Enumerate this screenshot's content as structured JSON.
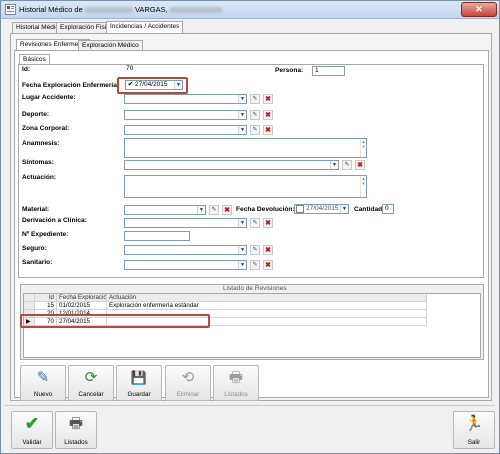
{
  "window": {
    "title": "Historial Médico de",
    "title_suffix": "VARGAS,",
    "close_glyph": "✕"
  },
  "top_tabs": [
    "Historial Médico",
    "Exploración Física",
    "Incidencias / Accidentes"
  ],
  "sub_tabs": [
    "Revisiones Enfermería",
    "Exploración Médico"
  ],
  "section_tabs": [
    "Básicos"
  ],
  "form": {
    "id_label": "Id:",
    "id_value": "70",
    "persona_label": "Persona:",
    "persona_value": "1",
    "fecha_label": "Fecha Exploración Enfermería:",
    "fecha_checked": "✔",
    "fecha_value": "27/04/2015",
    "lugar_label": "Lugar Accidente:",
    "deporte_label": "Deporte:",
    "zona_label": "Zona Corporal:",
    "anamnesis_label": "Anamnesis:",
    "sintomas_label": "Síntomas:",
    "actuacion_label": "Actuación:",
    "material_label": "Material:",
    "devolucion_label": "Fecha Devolución:",
    "devolucion_value": "27/04/2015",
    "cantidad_label": "Cantidad:",
    "cantidad_value": "0",
    "derivacion_label": "Derivación a Clínica:",
    "expediente_label": "Nº Expediente:",
    "seguro_label": "Seguro:",
    "sanitario_label": "Sanitario:",
    "arrow_glyph": "▼",
    "bin_glyph": "✎",
    "x_glyph": "✖"
  },
  "grid": {
    "title": "Listado de Revisiones",
    "columns": [
      "Id",
      "Fecha Exploración",
      "Actuación"
    ],
    "rows": [
      {
        "id": "15",
        "fecha": "01/02/2015",
        "actuacion": "Exploración enfermería estándar"
      },
      {
        "id": "20",
        "fecha": "12/01/2014",
        "actuacion": ""
      },
      {
        "id": "70",
        "fecha": "27/04/2015",
        "actuacion": ""
      }
    ],
    "row_indicator": "▶"
  },
  "toolbar": [
    {
      "label": "Nuevo",
      "icon": "✎",
      "color": "#3d6fb4",
      "enabled": true
    },
    {
      "label": "Cancelar",
      "icon": "⟳",
      "color": "#2f8a3a",
      "enabled": true
    },
    {
      "label": "Guardar",
      "icon": "💾",
      "color": "#2a4f9c",
      "enabled": true
    },
    {
      "label": "Eliminar",
      "icon": "⟲",
      "color": "#9a9a9a",
      "enabled": false
    },
    {
      "label": "Listados",
      "icon": "🖶",
      "color": "#9a9a9a",
      "enabled": false
    }
  ],
  "bottom": [
    {
      "label": "Validar",
      "icon": "✔",
      "color": "#2c9b2c"
    },
    {
      "label": "Listados",
      "icon": "🖶",
      "color": "#555555"
    },
    {
      "label": "Salir",
      "icon": "🏃",
      "color": "#1e8a1e"
    }
  ],
  "colors": {
    "highlight": "#b44a3a",
    "title_gradient": "#c2d6ee"
  }
}
